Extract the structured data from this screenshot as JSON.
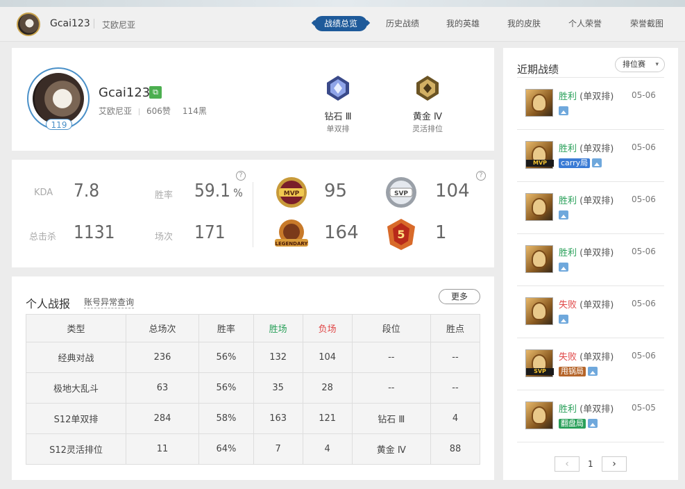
{
  "header": {
    "username": "Gcai123",
    "region": "艾欧尼亚",
    "tabs": [
      {
        "label": "战绩总览",
        "active": true
      },
      {
        "label": "历史战绩"
      },
      {
        "label": "我的英雄"
      },
      {
        "label": "我的皮肤"
      },
      {
        "label": "个人荣誉"
      },
      {
        "label": "荣誉截图"
      }
    ]
  },
  "profile": {
    "name": "Gcai123",
    "level": "119",
    "region": "艾欧尼亚",
    "likes": "606赞",
    "blacks": "114黑",
    "ranks": [
      {
        "tier": "钻石 Ⅲ",
        "queue": "单双排",
        "color": "#5a6fb0"
      },
      {
        "tier": "黄金 Ⅳ",
        "queue": "灵活排位",
        "color": "#a8893e"
      }
    ]
  },
  "stats": {
    "kda_label": "KDA",
    "kda": "7.8",
    "winrate_label": "胜率",
    "winrate": "59.1",
    "winrate_unit": "%",
    "kills_label": "总击杀",
    "kills": "1131",
    "games_label": "场次",
    "games": "171",
    "medals": [
      {
        "name": "MVP",
        "count": "95"
      },
      {
        "name": "SVP",
        "count": "104"
      },
      {
        "name": "LEGENDARY",
        "count": "164"
      },
      {
        "name": "5",
        "count": "1"
      }
    ]
  },
  "report": {
    "title": "个人战报",
    "link": "账号异常查询",
    "more": "更多",
    "columns": [
      "类型",
      "总场次",
      "胜率",
      "胜场",
      "负场",
      "段位",
      "胜点"
    ],
    "rows": [
      [
        "经典对战",
        "236",
        "56%",
        "132",
        "104",
        "--",
        "--"
      ],
      [
        "极地大乱斗",
        "63",
        "56%",
        "35",
        "28",
        "--",
        "--"
      ],
      [
        "S12单双排",
        "284",
        "58%",
        "163",
        "121",
        "钻石 Ⅲ",
        "4"
      ],
      [
        "S12灵活排位",
        "11",
        "64%",
        "7",
        "4",
        "黄金 Ⅳ",
        "88"
      ]
    ]
  },
  "recent": {
    "title": "近期战绩",
    "filter": "排位赛",
    "items": [
      {
        "result": "胜利",
        "mode": "(单双排)",
        "date": "05-06",
        "win": true,
        "tag": "",
        "badge": "",
        "badge_color": ""
      },
      {
        "result": "胜利",
        "mode": "(单双排)",
        "date": "05-06",
        "win": true,
        "tag": "MVP",
        "badge": "carry局",
        "badge_color": "#3a7bd5"
      },
      {
        "result": "胜利",
        "mode": "(单双排)",
        "date": "05-06",
        "win": true,
        "tag": "",
        "badge": "",
        "badge_color": ""
      },
      {
        "result": "胜利",
        "mode": "(单双排)",
        "date": "05-06",
        "win": true,
        "tag": "",
        "badge": "",
        "badge_color": ""
      },
      {
        "result": "失败",
        "mode": "(单双排)",
        "date": "05-06",
        "win": false,
        "tag": "",
        "badge": "",
        "badge_color": ""
      },
      {
        "result": "失败",
        "mode": "(单双排)",
        "date": "05-06",
        "win": false,
        "tag": "SVP",
        "badge": "甩锅局",
        "badge_color": "#b5652a"
      },
      {
        "result": "胜利",
        "mode": "(单双排)",
        "date": "05-05",
        "win": true,
        "tag": "",
        "badge": "翻盘局",
        "badge_color": "#2aa05a"
      }
    ],
    "page": "1"
  }
}
